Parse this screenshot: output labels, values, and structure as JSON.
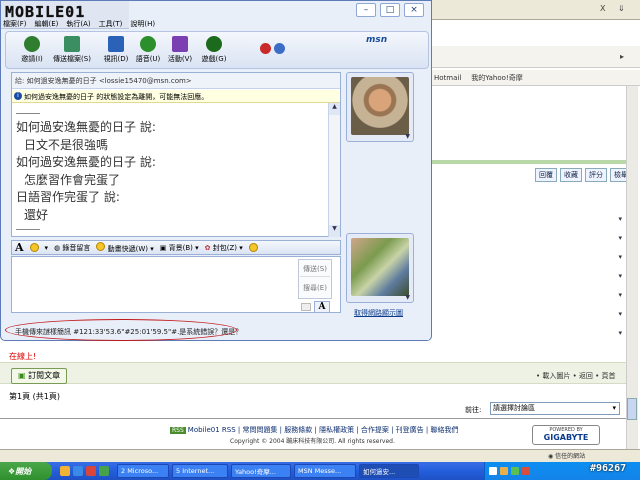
{
  "msn": {
    "logo": "MOBILE01",
    "menu": [
      "檔案(F)",
      "編輯(E)",
      "執行(A)",
      "工具(T)",
      "說明(H)"
    ],
    "window_buttons": [
      "–",
      "□",
      "×"
    ],
    "toolbar": [
      {
        "label": "邀請(I)",
        "icon": "invite-icon",
        "color": "#2f7d2f"
      },
      {
        "label": "傳送檔案(S)",
        "icon": "send-file-icon",
        "color": "#3a8e61"
      },
      {
        "label": "視訊(D)",
        "icon": "webcam-icon",
        "color": "#2a62b8"
      },
      {
        "label": "語音(U)",
        "icon": "voice-icon",
        "color": "#2b8f2b"
      },
      {
        "label": "活動(V)",
        "icon": "activities-icon",
        "color": "#7b3fb1"
      },
      {
        "label": "遊戲(G)",
        "icon": "games-icon",
        "color": "#1c6b1c"
      }
    ],
    "brand": "msn",
    "to_prefix": "給:",
    "to_value": "如何過安逸無憂的日子 <lossie15470@msn.com>",
    "warning": "如何過安逸無憂的日子 的狀態設定為離開，可能無法回應。",
    "chat_lines": [
      "如何過安逸無憂的日子 說:",
      "  日文不是很強嗎",
      "如何過安逸無憂的日子 說:",
      "  怎麼習作會完蛋了",
      "日語習作完蛋了 說:",
      "  還好"
    ],
    "compose_toolbar": [
      "A",
      "錄音留言",
      "動畫快遞(W)",
      "背景(B)",
      "封包(Z)"
    ],
    "send_label": "傳送(S)",
    "search_label": "搜尋(E)",
    "font_button": "A",
    "change_picture": "取得網路顯示圖",
    "status_text": "手機傳來謎樣簡訊 #121:33'53.6\"#25:01'59.5\"#.是系統錯誤？還是？"
  },
  "background_page": {
    "links": [
      "Hotmail",
      "我的Yahoo!奇摩"
    ],
    "topbar_controls": [
      "X",
      "⇓"
    ],
    "side_buttons": [
      "回覆",
      "收藏",
      "評分",
      "檢舉"
    ],
    "side_links": [
      "▾",
      "▾",
      "▾",
      "▾",
      "▾",
      "▾",
      "▾"
    ],
    "reply_text": "在線上!",
    "subscribe": "訂閱文章",
    "nav_right": "• 載入圖片 • 返回 • 頁首",
    "page_info": "第1頁 (共1頁)",
    "goto_label": "前往:",
    "goto_value": "請選擇討論區",
    "footer_rss": "RSS",
    "footer_links": "Mobile01 RSS | 常問問題集 | 服務條款 | 隱私權政策 | 合作提案 | 刊登廣告 | 聯絡我們",
    "copyright": "Copyright © 2004 蹦床科技有限公司. All rights reserved.",
    "powered_by": "POWERED BY",
    "gigabyte": "GIGABYTE",
    "trusted": "信任的網站"
  },
  "taskbar": {
    "start": "開始",
    "tasks": [
      "2 Microso...",
      "5 Internet...",
      "Yahoo!奇摩...",
      "MSN Messe...",
      "如何過安..."
    ],
    "watermark": "#96267"
  }
}
